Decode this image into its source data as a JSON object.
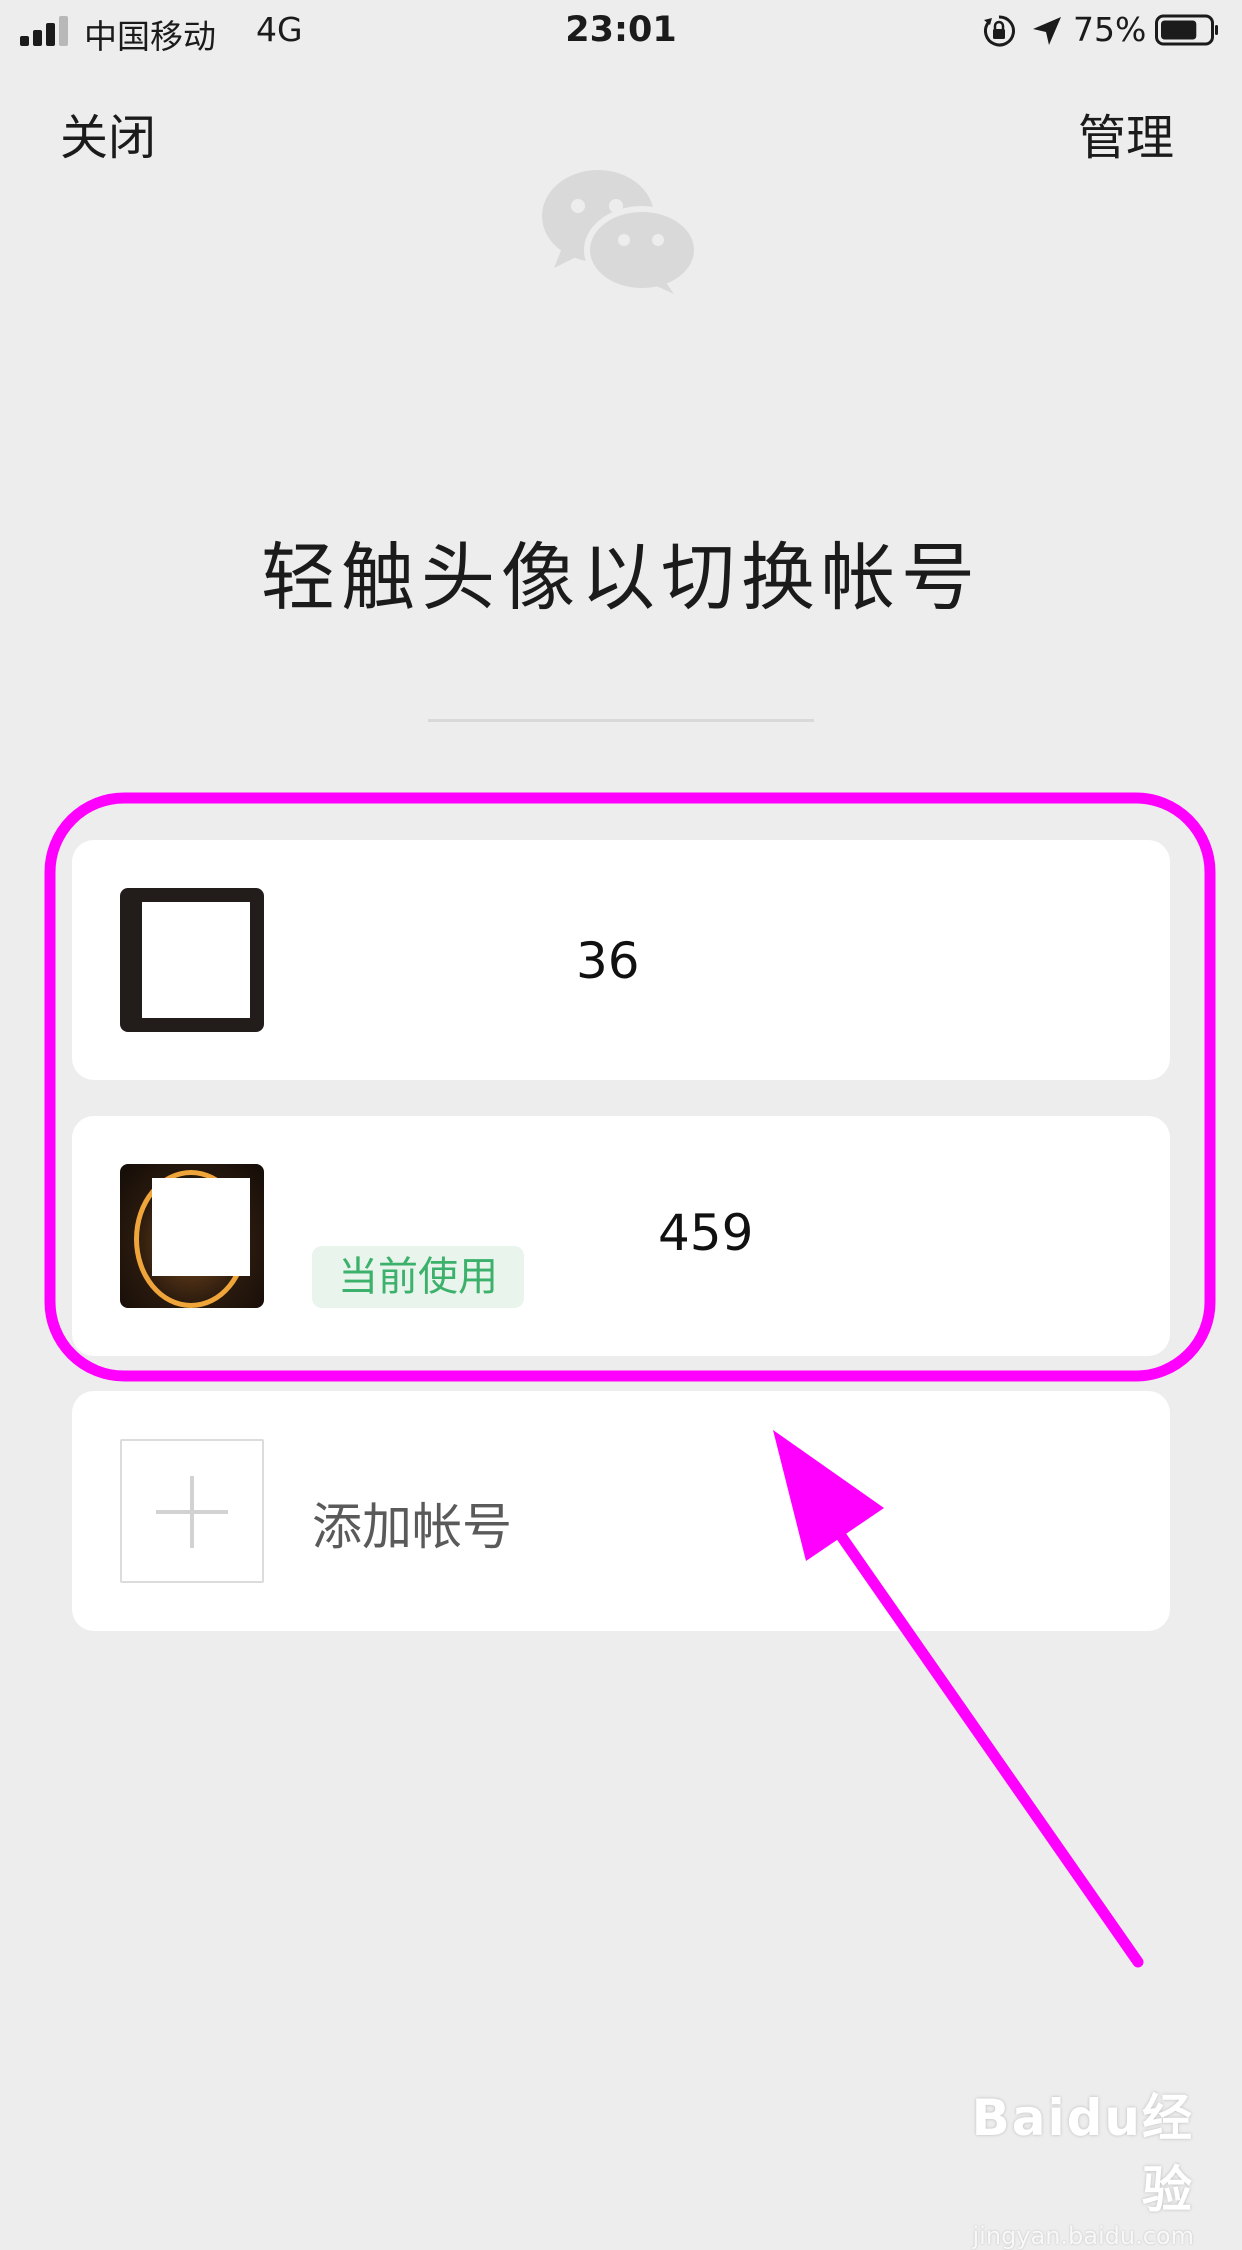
{
  "status_bar": {
    "carrier": "中国移动",
    "network": "4G",
    "time": "23:01",
    "battery_percent": "75%",
    "battery_level": 0.75,
    "signal_bars_filled": 3,
    "signal_bars_total": 4,
    "icons": [
      "signal-icon",
      "orientation-lock-icon",
      "location-arrow-icon",
      "battery-icon"
    ]
  },
  "nav": {
    "close_label": "关闭",
    "manage_label": "管理"
  },
  "logo_icon": "wechat-logo-icon",
  "heading": "轻触头像以切换帐号",
  "accounts": [
    {
      "name": "36",
      "avatar_icon": "avatar-image"
    },
    {
      "name": "459",
      "badge": "当前使用",
      "avatar_icon": "avatar-image"
    }
  ],
  "add_account": {
    "label": "添加帐号",
    "icon": "plus-icon"
  },
  "annotation": {
    "color": "#ff00ff",
    "shapes": [
      "highlight-rounded-rectangle",
      "pointer-arrow"
    ]
  },
  "watermark": {
    "brand": "Baidu经验",
    "url": "jingyan.baidu.com"
  },
  "colors": {
    "background": "#ededed",
    "card": "#ffffff",
    "badge_bg": "#e8f4ec",
    "badge_text": "#3cb16b",
    "annotation": "#ff00ff"
  }
}
